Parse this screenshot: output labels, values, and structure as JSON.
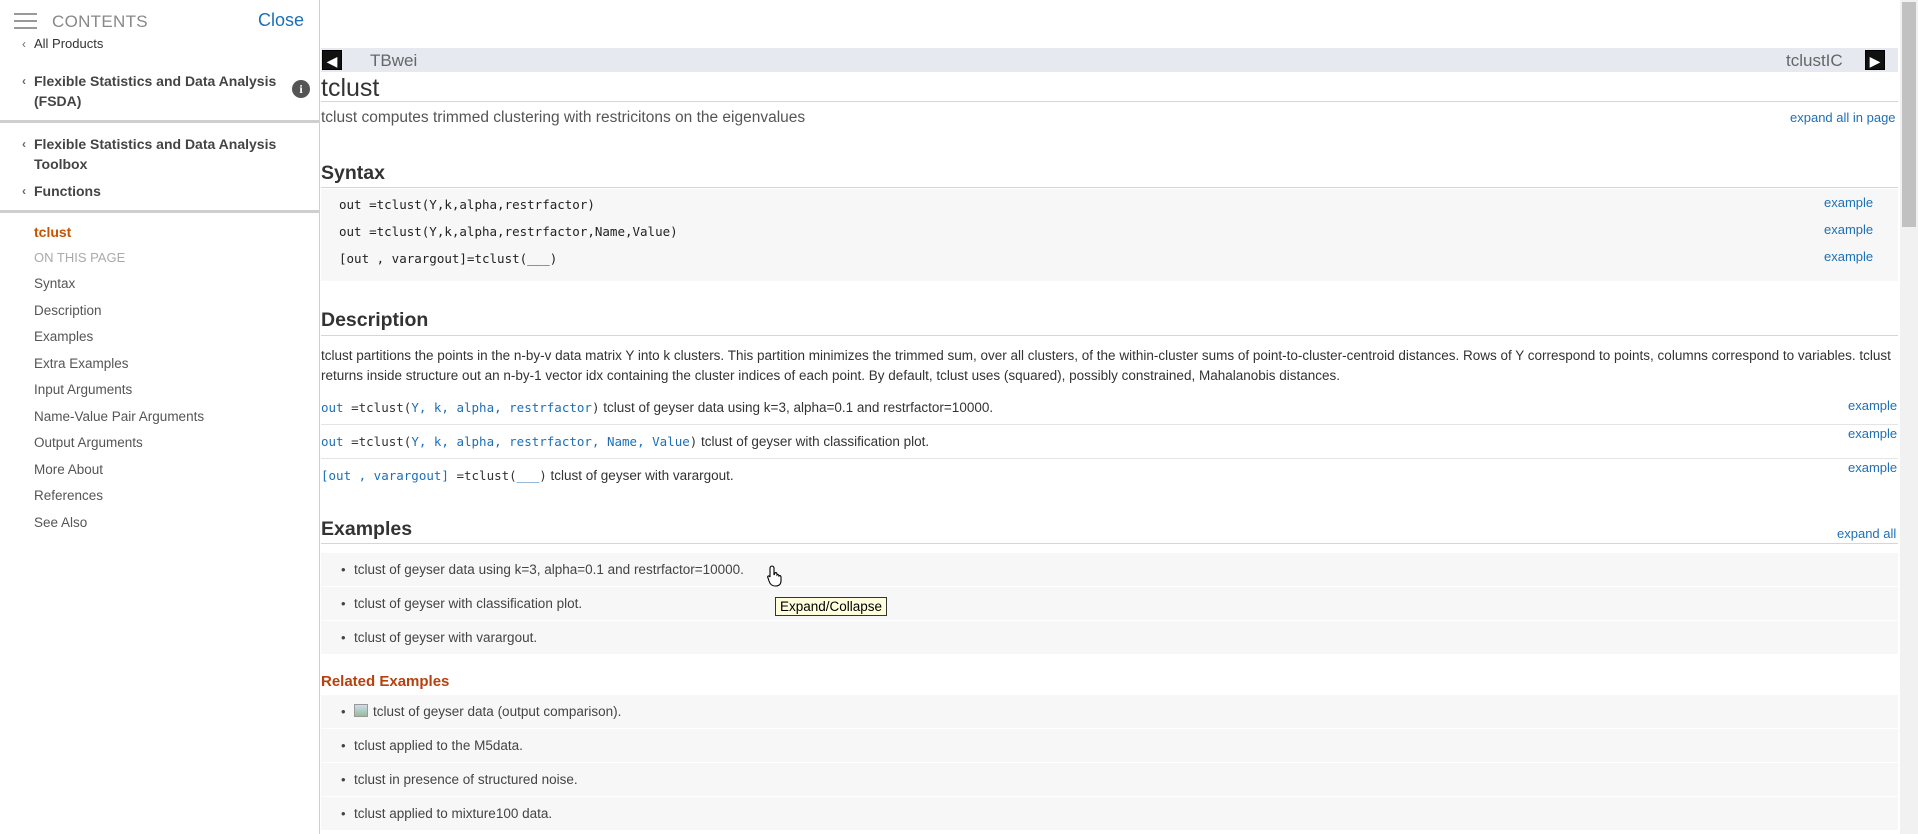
{
  "sidebar": {
    "contents_title": "CONTENTS",
    "close_label": "Close",
    "all_products": "All Products",
    "breadcrumbs": [
      "Flexible Statistics and Data Analysis (FSDA)",
      "Flexible Statistics and Data Analysis Toolbox",
      "Functions"
    ],
    "current_page": "tclust",
    "on_this_page": "ON THIS PAGE",
    "nav_items": [
      "Syntax",
      "Description",
      "Examples",
      "Extra Examples",
      "Input Arguments",
      "Name-Value Pair Arguments",
      "Output Arguments",
      "More About",
      "References",
      "See Also"
    ]
  },
  "topnav": {
    "prev": "TBwei",
    "next": "tclustIC"
  },
  "page": {
    "title": "tclust",
    "purpose": "tclust computes trimmed clustering with restricitons on the eigenvalues",
    "expand_all_in_page": "expand all in page"
  },
  "syntax": {
    "heading": "Syntax",
    "rows": [
      "out =tclust(Y,k,alpha,restrfactor)",
      "out =tclust(Y,k,alpha,restrfactor,Name,Value)",
      "[out , varargout]=tclust(___)"
    ],
    "example_label": "example"
  },
  "description": {
    "heading": "Description",
    "text": "tclust partitions the points in the n-by-v data matrix Y into k clusters. This partition minimizes the trimmed sum, over all clusters, of the within-cluster sums of point-to-cluster-centroid distances. Rows of Y correspond to points, columns correspond to variables. tclust returns inside structure out an n-by-1 vector idx containing the cluster indices of each point. By default, tclust uses (squared), possibly constrained, Mahalanobis distances.",
    "calls": [
      {
        "lhs": "out",
        "fn": " =tclust(",
        "args": "Y, k, alpha, restrfactor",
        "close": ")",
        "summary": " tclust of geyser data using k=3, alpha=0.1 and restrfactor=10000."
      },
      {
        "lhs": "out",
        "fn": " =tclust(",
        "args": "Y, k, alpha, restrfactor, Name, Value",
        "close": ")",
        "summary": " tclust of geyser with classification plot."
      },
      {
        "lhs": "[out , varargout]",
        "fn": " =tclust(",
        "args": "___",
        "close": ")",
        "summary": " tclust of geyser with varargout."
      }
    ]
  },
  "examples": {
    "heading": "Examples",
    "expand_all": "expand all",
    "items": [
      "tclust of geyser data using k=3, alpha=0.1 and restrfactor=10000.",
      "tclust of geyser with classification plot.",
      "tclust of geyser with varargout."
    ],
    "tooltip": "Expand/Collapse"
  },
  "related": {
    "heading": "Related Examples",
    "items": [
      "tclust of geyser data (output comparison).",
      "tclust applied to the M5data.",
      "tclust in presence of structured noise.",
      "tclust applied to mixture100 data."
    ]
  },
  "colors": {
    "link": "#1d6fb8",
    "current": "#c45400",
    "related_heading": "#b7410e",
    "tooltip_bg": "#ffffdd"
  }
}
